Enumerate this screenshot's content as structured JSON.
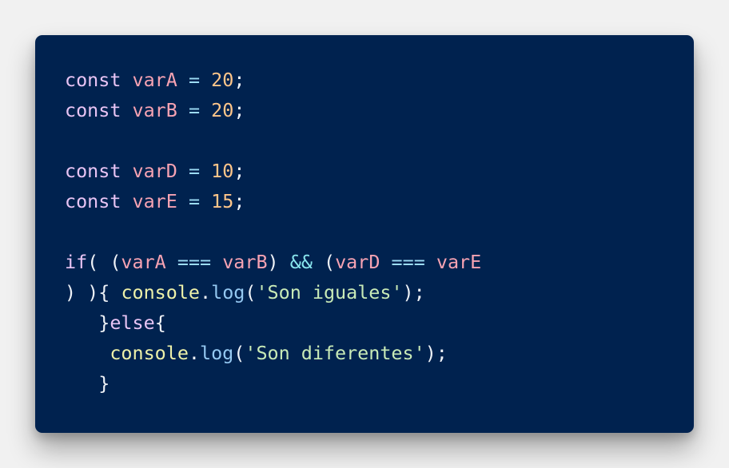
{
  "code": {
    "line1": {
      "kw": "const",
      "name": "varA",
      "op": "=",
      "value": "20",
      "end": ";"
    },
    "line2": {
      "kw": "const",
      "name": "varB",
      "op": "=",
      "value": "20",
      "end": ";"
    },
    "line4": {
      "kw": "const",
      "name": "varD",
      "op": "=",
      "value": "10",
      "end": ";"
    },
    "line5": {
      "kw": "const",
      "name": "varE",
      "op": "=",
      "value": "15",
      "end": ";"
    },
    "line7": {
      "kw": "if",
      "open": "( (",
      "var_a": "varA",
      "eq1": "===",
      "var_b": "varB",
      "close1": ")",
      "and": "&&",
      "open2": "(",
      "var_d": "varD",
      "eq2": "===",
      "var_e": "varE"
    },
    "line8": {
      "prefix": ") ){",
      "obj": "console",
      "dot": ".",
      "method": "log",
      "open": "(",
      "string": "'Son iguales'",
      "close": ");"
    },
    "line9": {
      "brace_close": "}",
      "kw": "else",
      "brace_open": "{"
    },
    "line10": {
      "obj": "console",
      "dot": ".",
      "method": "log",
      "open": "(",
      "string": "'Son diferentes'",
      "close": ");"
    },
    "line11": {
      "brace": "}"
    }
  },
  "colors": {
    "page_background": "#f1f1f1",
    "card_background": "#00224f",
    "keyword": "#e8c4f4",
    "variable": "#f7a3b3",
    "number": "#ffc68a",
    "string": "#c8eab7",
    "function": "#eef1a9",
    "property": "#95c9f2"
  }
}
